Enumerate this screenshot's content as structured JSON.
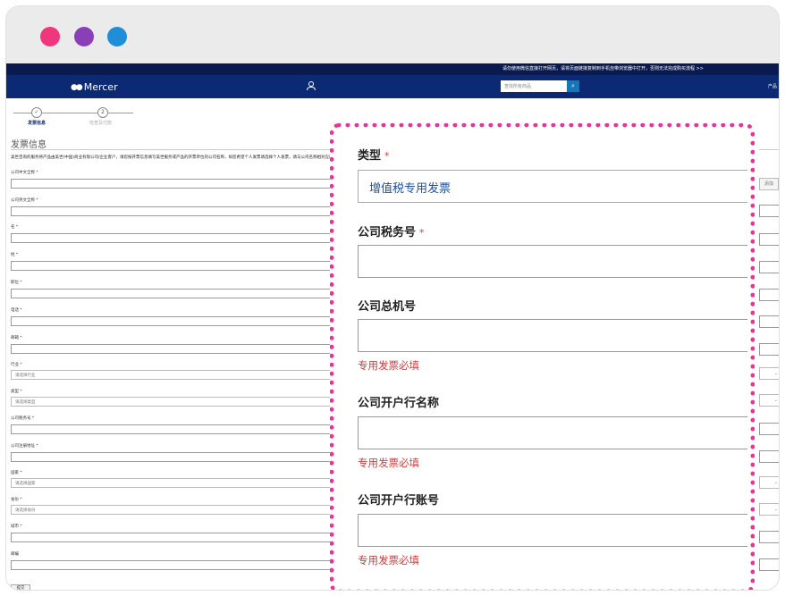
{
  "window": {
    "controls": [
      "close",
      "minimize",
      "maximize"
    ],
    "colors": {
      "close": "#f0367d",
      "minimize": "#8a3fb8",
      "maximize": "#1e8ed8"
    }
  },
  "site": {
    "top_notice": "请勿使用微信直接打开网页，请将页面链接复制到手机自带浏览器中打开，否则无法完成购买流程 >>",
    "brand": "Mercer",
    "search_placeholder": "查找所有商品",
    "nav_right": "产品",
    "colors": {
      "navbar": "#0c2a73",
      "topbar": "#0a1a4f",
      "accent": "#e4359c",
      "error": "#d93b3b"
    }
  },
  "steps": [
    {
      "label": "发票信息",
      "state": "done",
      "marker": "✓"
    },
    {
      "label": "检查及付款",
      "state": "pending",
      "marker": "2"
    }
  ],
  "form": {
    "section_title": "发票信息",
    "notice": "美世咨询的服务将产品由美世(中国)商业有限公司/企业客户，请您按开票信息填写美世服务或产品的开票单位的公司名称，如您希望个人发票请选择个人发票，请与公司名称相对应的公司发票信息，不能开具不正确的发票信息",
    "fields": [
      {
        "label": "公司中文全称 *",
        "kind": "input"
      },
      {
        "label": "公司英文全称 *",
        "kind": "input"
      },
      {
        "label": "名 *",
        "kind": "input"
      },
      {
        "label": "姓 *",
        "kind": "input"
      },
      {
        "label": "职位 *",
        "kind": "input"
      },
      {
        "label": "电话 *",
        "kind": "input"
      },
      {
        "label": "邮箱 *",
        "kind": "input"
      },
      {
        "label": "行业 *",
        "kind": "select",
        "value": "请选择行业"
      },
      {
        "label": "类型 *",
        "kind": "select",
        "value": "请选择类型"
      },
      {
        "label": "公司税务号 *",
        "kind": "input"
      },
      {
        "label": "公司注册地址 *",
        "kind": "input"
      },
      {
        "label": "国家 *",
        "kind": "select",
        "value": "请选择国家"
      },
      {
        "label": "省份 *",
        "kind": "select",
        "value": "请选择省份"
      },
      {
        "label": "城市 *",
        "kind": "input"
      },
      {
        "label": "邮编",
        "kind": "input"
      }
    ],
    "submit_label": "提交",
    "right_button_label": "添加"
  },
  "callout": {
    "type_label": "类型",
    "type_value": "增值税专用发票",
    "tax_label": "公司税务号",
    "phone_label": "公司总机号",
    "bank_name_label": "公司开户行名称",
    "bank_account_label": "公司开户行账号",
    "required_mark": "*",
    "required_note": "专用发票必填"
  }
}
